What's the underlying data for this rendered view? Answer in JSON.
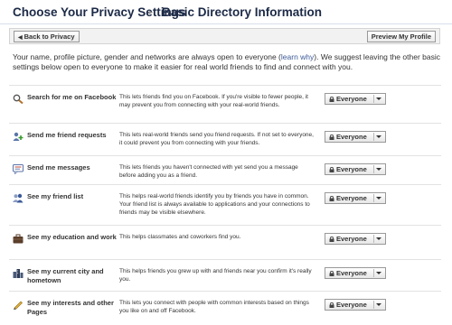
{
  "header": {
    "title": "Choose Your Privacy Settings",
    "separator": "▸",
    "subtitle": "Basic Directory Information"
  },
  "toolbar": {
    "back_label": "Back to Privacy",
    "preview_label": "Preview My Profile"
  },
  "intro": {
    "text_before": "Your name, profile picture, gender and networks are always open to everyone (",
    "link": "learn why",
    "text_after": "). We suggest leaving the other basic settings below open to everyone to make it easier for real world friends to find and connect with you."
  },
  "settings": [
    {
      "label": "Search for me on Facebook",
      "icon": "search-icon",
      "description": "This lets friends find you on Facebook. If you're visible to fewer people, it may prevent you from connecting with your real-world friends.",
      "value": "Everyone"
    },
    {
      "label": "Send me friend requests",
      "icon": "add-friend-icon",
      "description": "This lets real-world friends send you friend requests. If not set to everyone, it could prevent you from connecting with your friends.",
      "value": "Everyone"
    },
    {
      "label": "Send me messages",
      "icon": "message-icon",
      "description": "This lets friends you haven't connected with yet send you a message before adding you as a friend.",
      "value": "Everyone"
    },
    {
      "label": "See my friend list",
      "icon": "friends-icon",
      "description": "This helps real-world friends identify you by friends you have in common. Your friend list is always available to applications and your connections to friends may be visible elsewhere.",
      "value": "Everyone"
    },
    {
      "label": "See my education and work",
      "icon": "briefcase-icon",
      "description": "This helps classmates and coworkers find you.",
      "value": "Everyone"
    },
    {
      "label": "See my current city and hometown",
      "icon": "city-icon",
      "description": "This helps friends you grew up with and friends near you confirm it's really you.",
      "value": "Everyone"
    },
    {
      "label": "See my interests and other Pages",
      "icon": "pencil-icon",
      "description": "This lets you connect with people with common interests based on things you like on and off Facebook.",
      "value": "Everyone"
    }
  ]
}
